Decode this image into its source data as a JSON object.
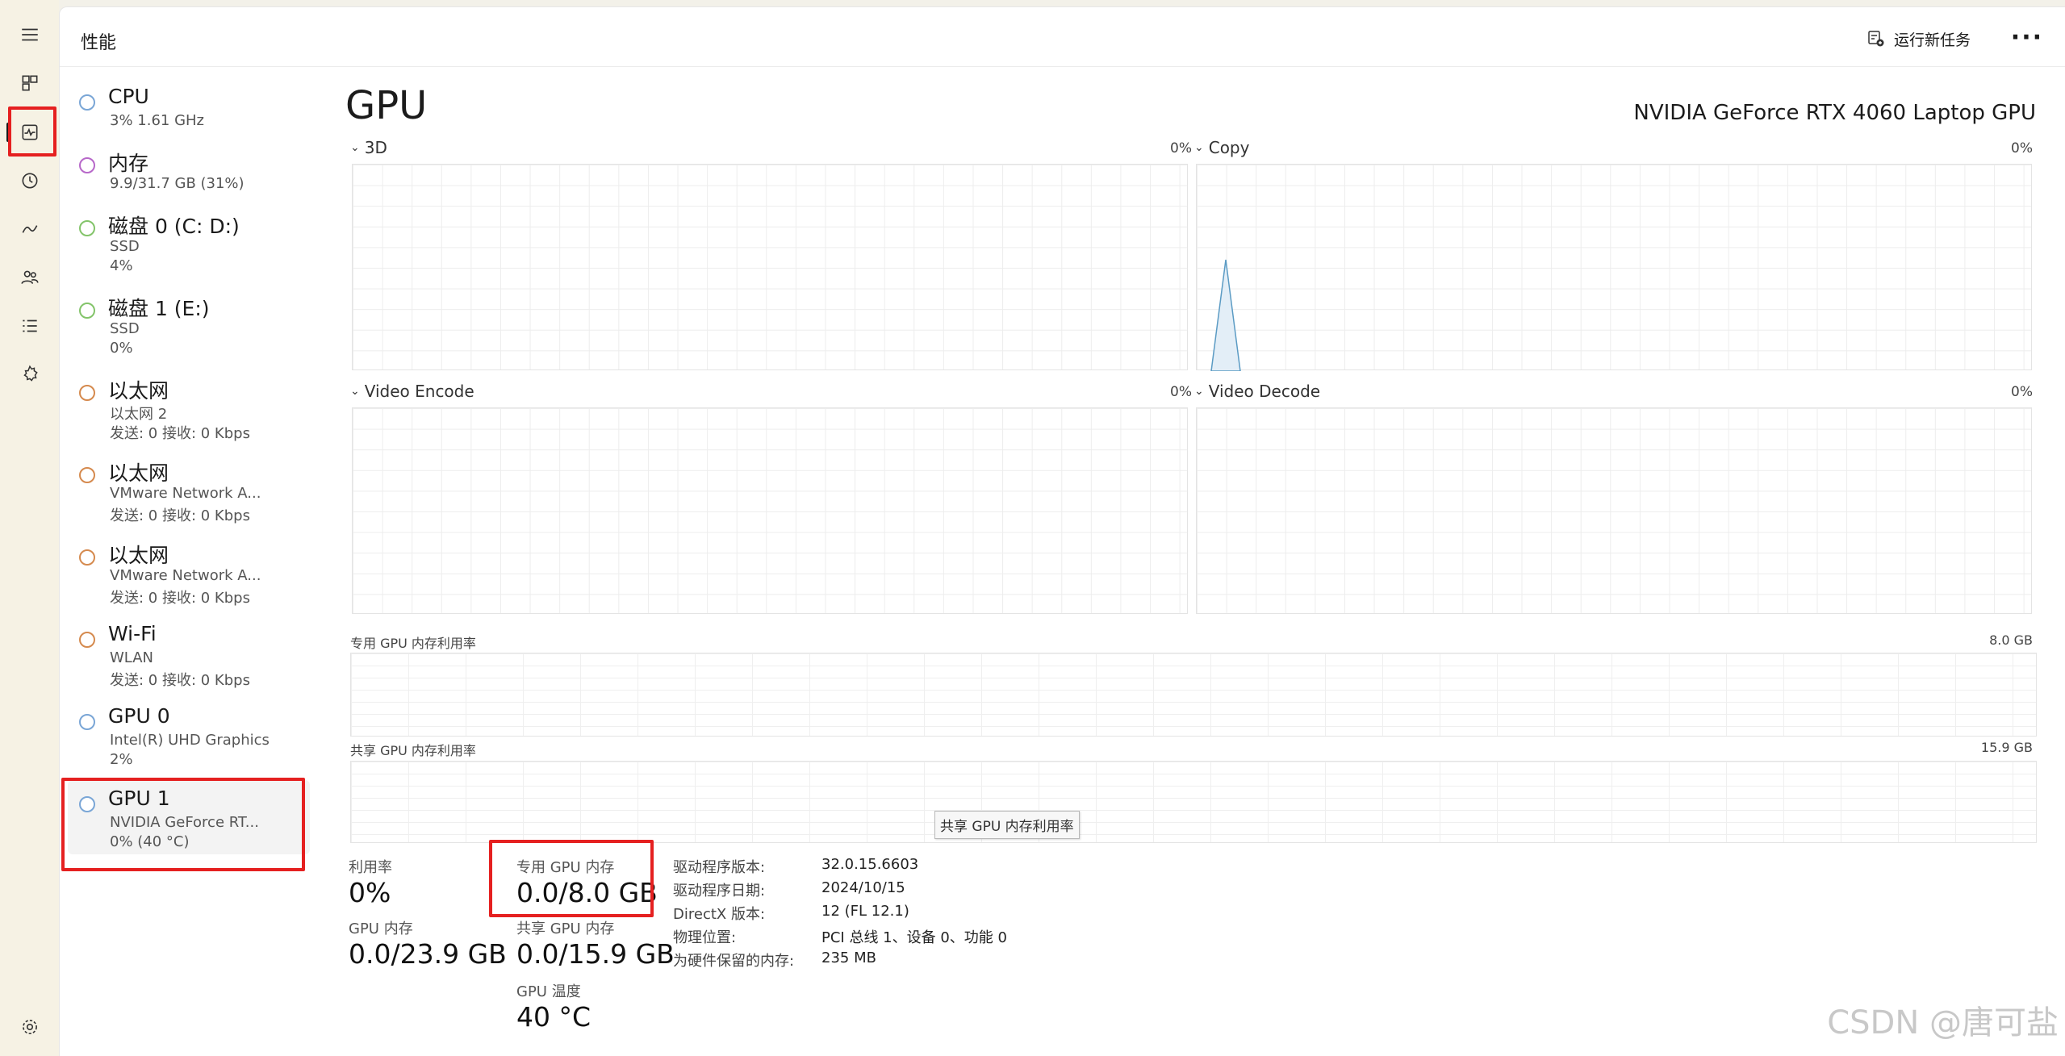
{
  "rail": {
    "icons": [
      "hamburger-icon",
      "processes-icon",
      "performance-icon",
      "app-history-icon",
      "startup-apps-icon",
      "users-icon",
      "details-icon",
      "services-icon",
      "settings-icon"
    ]
  },
  "header": {
    "title": "性能",
    "run_task": "运行新任务",
    "more": "···"
  },
  "sidebar": {
    "items": [
      {
        "name": "CPU",
        "sub1": "3%  1.61 GHz",
        "sub2": "",
        "color": "#7aa6d6"
      },
      {
        "name": "内存",
        "sub1": "9.9/31.7 GB (31%)",
        "sub2": "",
        "color": "#b768c9"
      },
      {
        "name": "磁盘 0 (C: D:)",
        "sub1": "SSD",
        "sub2": "4%",
        "color": "#83c46a"
      },
      {
        "name": "磁盘 1 (E:)",
        "sub1": "SSD",
        "sub2": "0%",
        "color": "#83c46a"
      },
      {
        "name": "以太网",
        "sub1": "以太网 2",
        "sub2": "发送: 0 接收: 0 Kbps",
        "color": "#d58a4e"
      },
      {
        "name": "以太网",
        "sub1": "VMware Network A...",
        "sub2": "发送: 0 接收: 0 Kbps",
        "color": "#d58a4e"
      },
      {
        "name": "以太网",
        "sub1": "VMware Network A...",
        "sub2": "发送: 0 接收: 0 Kbps",
        "color": "#d58a4e"
      },
      {
        "name": "Wi-Fi",
        "sub1": "WLAN",
        "sub2": "发送: 0 接收: 0 Kbps",
        "color": "#d58a4e"
      },
      {
        "name": "GPU 0",
        "sub1": "Intel(R) UHD Graphics",
        "sub2": "2%",
        "color": "#7aa6d6"
      },
      {
        "name": "GPU 1",
        "sub1": "NVIDIA GeForce RT...",
        "sub2": "0% (40 °C)",
        "color": "#7aa6d6"
      }
    ]
  },
  "main": {
    "heading": "GPU",
    "model": "NVIDIA GeForce RTX 4060 Laptop GPU",
    "graphs": [
      {
        "label": "3D",
        "pct": "0%"
      },
      {
        "label": "Copy",
        "pct": "0%"
      },
      {
        "label": "Video Encode",
        "pct": "0%"
      },
      {
        "label": "Video Decode",
        "pct": "0%"
      }
    ],
    "dedicated_mem_label": "专用 GPU 内存利用率",
    "dedicated_mem_max": "8.0 GB",
    "shared_mem_label": "共享 GPU 内存利用率",
    "shared_mem_max": "15.9 GB",
    "tooltip": "共享 GPU 内存利用率",
    "stats": {
      "util_label": "利用率",
      "util_val": "0%",
      "ded_label": "专用 GPU 内存",
      "ded_val": "0.0/8.0 GB",
      "gpu_mem_label": "GPU 内存",
      "gpu_mem_val": "0.0/23.9 GB",
      "shared_label": "共享 GPU 内存",
      "shared_val": "0.0/15.9 GB",
      "temp_label": "GPU 温度",
      "temp_val": "40 °C"
    },
    "info": [
      {
        "key": "驱动程序版本:",
        "val": "32.0.15.6603"
      },
      {
        "key": "驱动程序日期:",
        "val": "2024/10/15"
      },
      {
        "key": "DirectX 版本:",
        "val": "12 (FL 12.1)"
      },
      {
        "key": "物理位置:",
        "val": "PCI 总线 1、设备 0、功能 0"
      },
      {
        "key": "为硬件保留的内存:",
        "val": "235 MB"
      }
    ]
  },
  "watermark": "CSDN @唐可盐",
  "colors": {
    "highlight": "#e52020",
    "graph_line": "#5b9bc4"
  }
}
